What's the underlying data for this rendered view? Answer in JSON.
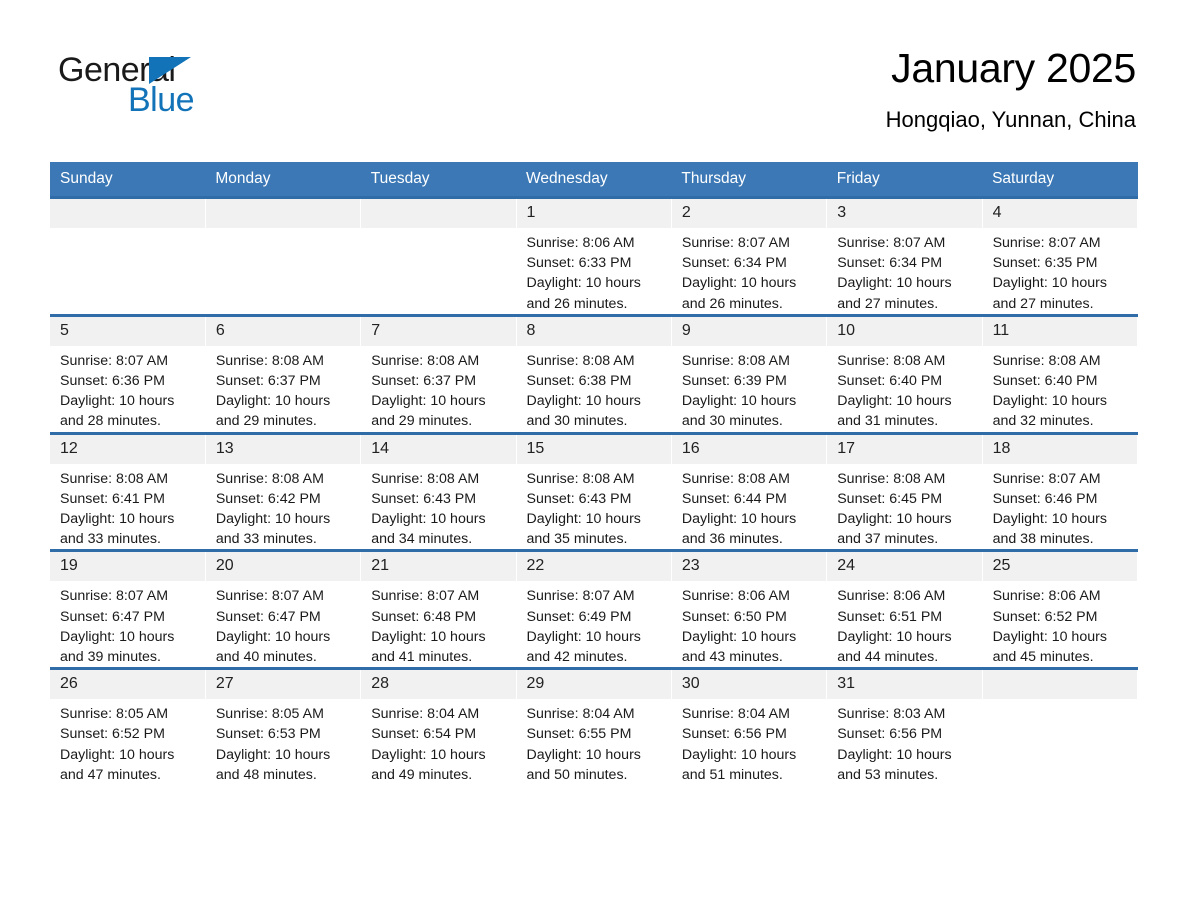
{
  "brand": {
    "name_top": "General",
    "name_bottom": "Blue",
    "accent_color": "#1273b8"
  },
  "header": {
    "title": "January 2025",
    "subtitle": "Hongqiao, Yunnan, China"
  },
  "theme": {
    "header_blue": "#3b78b5",
    "row_rule_blue": "#2f6ca8",
    "daynum_band": "#f1f1f1"
  },
  "weekday_headers": [
    "Sunday",
    "Monday",
    "Tuesday",
    "Wednesday",
    "Thursday",
    "Friday",
    "Saturday"
  ],
  "weeks": [
    [
      {
        "day": "",
        "lines": []
      },
      {
        "day": "",
        "lines": []
      },
      {
        "day": "",
        "lines": []
      },
      {
        "day": "1",
        "lines": [
          "Sunrise: 8:06 AM",
          "Sunset: 6:33 PM",
          "Daylight: 10 hours",
          "and 26 minutes."
        ]
      },
      {
        "day": "2",
        "lines": [
          "Sunrise: 8:07 AM",
          "Sunset: 6:34 PM",
          "Daylight: 10 hours",
          "and 26 minutes."
        ]
      },
      {
        "day": "3",
        "lines": [
          "Sunrise: 8:07 AM",
          "Sunset: 6:34 PM",
          "Daylight: 10 hours",
          "and 27 minutes."
        ]
      },
      {
        "day": "4",
        "lines": [
          "Sunrise: 8:07 AM",
          "Sunset: 6:35 PM",
          "Daylight: 10 hours",
          "and 27 minutes."
        ]
      }
    ],
    [
      {
        "day": "5",
        "lines": [
          "Sunrise: 8:07 AM",
          "Sunset: 6:36 PM",
          "Daylight: 10 hours",
          "and 28 minutes."
        ]
      },
      {
        "day": "6",
        "lines": [
          "Sunrise: 8:08 AM",
          "Sunset: 6:37 PM",
          "Daylight: 10 hours",
          "and 29 minutes."
        ]
      },
      {
        "day": "7",
        "lines": [
          "Sunrise: 8:08 AM",
          "Sunset: 6:37 PM",
          "Daylight: 10 hours",
          "and 29 minutes."
        ]
      },
      {
        "day": "8",
        "lines": [
          "Sunrise: 8:08 AM",
          "Sunset: 6:38 PM",
          "Daylight: 10 hours",
          "and 30 minutes."
        ]
      },
      {
        "day": "9",
        "lines": [
          "Sunrise: 8:08 AM",
          "Sunset: 6:39 PM",
          "Daylight: 10 hours",
          "and 30 minutes."
        ]
      },
      {
        "day": "10",
        "lines": [
          "Sunrise: 8:08 AM",
          "Sunset: 6:40 PM",
          "Daylight: 10 hours",
          "and 31 minutes."
        ]
      },
      {
        "day": "11",
        "lines": [
          "Sunrise: 8:08 AM",
          "Sunset: 6:40 PM",
          "Daylight: 10 hours",
          "and 32 minutes."
        ]
      }
    ],
    [
      {
        "day": "12",
        "lines": [
          "Sunrise: 8:08 AM",
          "Sunset: 6:41 PM",
          "Daylight: 10 hours",
          "and 33 minutes."
        ]
      },
      {
        "day": "13",
        "lines": [
          "Sunrise: 8:08 AM",
          "Sunset: 6:42 PM",
          "Daylight: 10 hours",
          "and 33 minutes."
        ]
      },
      {
        "day": "14",
        "lines": [
          "Sunrise: 8:08 AM",
          "Sunset: 6:43 PM",
          "Daylight: 10 hours",
          "and 34 minutes."
        ]
      },
      {
        "day": "15",
        "lines": [
          "Sunrise: 8:08 AM",
          "Sunset: 6:43 PM",
          "Daylight: 10 hours",
          "and 35 minutes."
        ]
      },
      {
        "day": "16",
        "lines": [
          "Sunrise: 8:08 AM",
          "Sunset: 6:44 PM",
          "Daylight: 10 hours",
          "and 36 minutes."
        ]
      },
      {
        "day": "17",
        "lines": [
          "Sunrise: 8:08 AM",
          "Sunset: 6:45 PM",
          "Daylight: 10 hours",
          "and 37 minutes."
        ]
      },
      {
        "day": "18",
        "lines": [
          "Sunrise: 8:07 AM",
          "Sunset: 6:46 PM",
          "Daylight: 10 hours",
          "and 38 minutes."
        ]
      }
    ],
    [
      {
        "day": "19",
        "lines": [
          "Sunrise: 8:07 AM",
          "Sunset: 6:47 PM",
          "Daylight: 10 hours",
          "and 39 minutes."
        ]
      },
      {
        "day": "20",
        "lines": [
          "Sunrise: 8:07 AM",
          "Sunset: 6:47 PM",
          "Daylight: 10 hours",
          "and 40 minutes."
        ]
      },
      {
        "day": "21",
        "lines": [
          "Sunrise: 8:07 AM",
          "Sunset: 6:48 PM",
          "Daylight: 10 hours",
          "and 41 minutes."
        ]
      },
      {
        "day": "22",
        "lines": [
          "Sunrise: 8:07 AM",
          "Sunset: 6:49 PM",
          "Daylight: 10 hours",
          "and 42 minutes."
        ]
      },
      {
        "day": "23",
        "lines": [
          "Sunrise: 8:06 AM",
          "Sunset: 6:50 PM",
          "Daylight: 10 hours",
          "and 43 minutes."
        ]
      },
      {
        "day": "24",
        "lines": [
          "Sunrise: 8:06 AM",
          "Sunset: 6:51 PM",
          "Daylight: 10 hours",
          "and 44 minutes."
        ]
      },
      {
        "day": "25",
        "lines": [
          "Sunrise: 8:06 AM",
          "Sunset: 6:52 PM",
          "Daylight: 10 hours",
          "and 45 minutes."
        ]
      }
    ],
    [
      {
        "day": "26",
        "lines": [
          "Sunrise: 8:05 AM",
          "Sunset: 6:52 PM",
          "Daylight: 10 hours",
          "and 47 minutes."
        ]
      },
      {
        "day": "27",
        "lines": [
          "Sunrise: 8:05 AM",
          "Sunset: 6:53 PM",
          "Daylight: 10 hours",
          "and 48 minutes."
        ]
      },
      {
        "day": "28",
        "lines": [
          "Sunrise: 8:04 AM",
          "Sunset: 6:54 PM",
          "Daylight: 10 hours",
          "and 49 minutes."
        ]
      },
      {
        "day": "29",
        "lines": [
          "Sunrise: 8:04 AM",
          "Sunset: 6:55 PM",
          "Daylight: 10 hours",
          "and 50 minutes."
        ]
      },
      {
        "day": "30",
        "lines": [
          "Sunrise: 8:04 AM",
          "Sunset: 6:56 PM",
          "Daylight: 10 hours",
          "and 51 minutes."
        ]
      },
      {
        "day": "31",
        "lines": [
          "Sunrise: 8:03 AM",
          "Sunset: 6:56 PM",
          "Daylight: 10 hours",
          "and 53 minutes."
        ]
      },
      {
        "day": "",
        "lines": []
      }
    ]
  ]
}
